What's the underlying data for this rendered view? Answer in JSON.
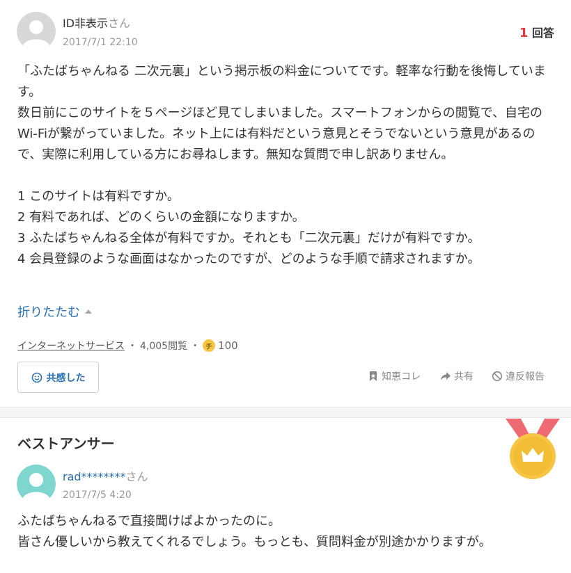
{
  "question": {
    "user": {
      "name": "ID非表示",
      "suffix": "さん"
    },
    "date": "2017/7/1 22:10",
    "answer_count": {
      "number": "1",
      "label": "回答"
    },
    "body": "「ふたばちゃんねる 二次元裏」という掲示板の料金についてです。軽率な行動を後悔しています。\n数日前にこのサイトを５ページほど見てしまいました。スマートフォンからの閲覧で、自宅のWi-Fiが繋がっていました。ネット上には有料だという意見とそうでないという意見があるので、実際に利用している方にお尋ねします。無知な質問で申し訳ありません。\n\n1 このサイトは有料ですか。\n2 有料であれば、どのくらいの金額になりますか。\n3 ふたばちゃんねる全体が有料ですか。それとも「二次元裏」だけが有料ですか。\n4 会員登録のような画面はなかったのですが、どのような手順で請求されますか。",
    "collapse_label": "折りたたむ",
    "category": "インターネットサービス",
    "views": "4,005閲覧",
    "coin_symbol": "チ",
    "coins": "100",
    "empathy_button": "共感した",
    "actions": {
      "bookmark": "知恵コレ",
      "share": "共有",
      "report": "違反報告"
    }
  },
  "best_answer": {
    "heading": "ベストアンサー",
    "user": {
      "name": "rad********",
      "suffix": "さん"
    },
    "date": "2017/7/5 4:20",
    "body": "ふたばちゃんねるで直接聞けばよかったのに。\n皆さん優しいから教えてくれるでしょう。もっとも、質問料金が別途かかりますが。"
  },
  "colors": {
    "link": "#2a6fb4",
    "accent_red": "#e0393e",
    "medal_gold": "#f5c543",
    "medal_ribbon": "#ee6b73",
    "avatar_teal": "#7ed6cf"
  },
  "icons": [
    "avatar-icon",
    "chevron-up-icon",
    "coin-icon",
    "smiley-icon",
    "bookmark-icon",
    "share-icon",
    "report-icon",
    "medal-icon"
  ]
}
